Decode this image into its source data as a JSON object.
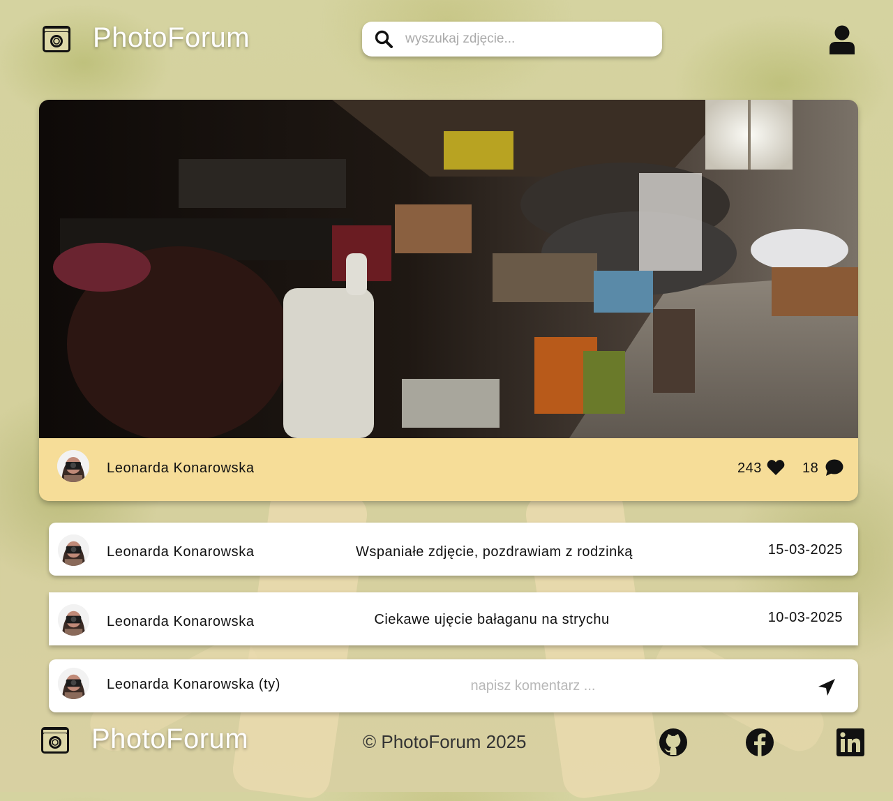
{
  "header": {
    "brand": "PhotoForum",
    "search_placeholder": "wyszukaj zdjęcie..."
  },
  "post": {
    "author": "Leonarda Konarowska",
    "likes": "243",
    "comments_count": "18"
  },
  "comments": [
    {
      "author": "Leonarda Konarowska",
      "text": "Wspaniałe zdjęcie, pozdrawiam z rodzinką",
      "date": "15-03-2025"
    },
    {
      "author": "Leonarda Konarowska",
      "text": "Ciekawe ujęcie bałaganu na strychu",
      "date": "10-03-2025"
    }
  ],
  "new_comment": {
    "author": "Leonarda Konarowska (ty)",
    "placeholder": "napisz komentarz ..."
  },
  "footer": {
    "brand": "PhotoForum",
    "copyright": "© PhotoForum 2025"
  },
  "icons": {
    "logo": "camera-icon",
    "search": "search-icon",
    "user": "user-icon",
    "like": "heart-icon",
    "comment": "comment-icon",
    "send": "send-icon",
    "github": "github-icon",
    "facebook": "facebook-icon",
    "linkedin": "linkedin-icon"
  },
  "colors": {
    "meta_bar": "#f6dd98",
    "card": "#ffffff",
    "brand_text": "#ffffff"
  }
}
